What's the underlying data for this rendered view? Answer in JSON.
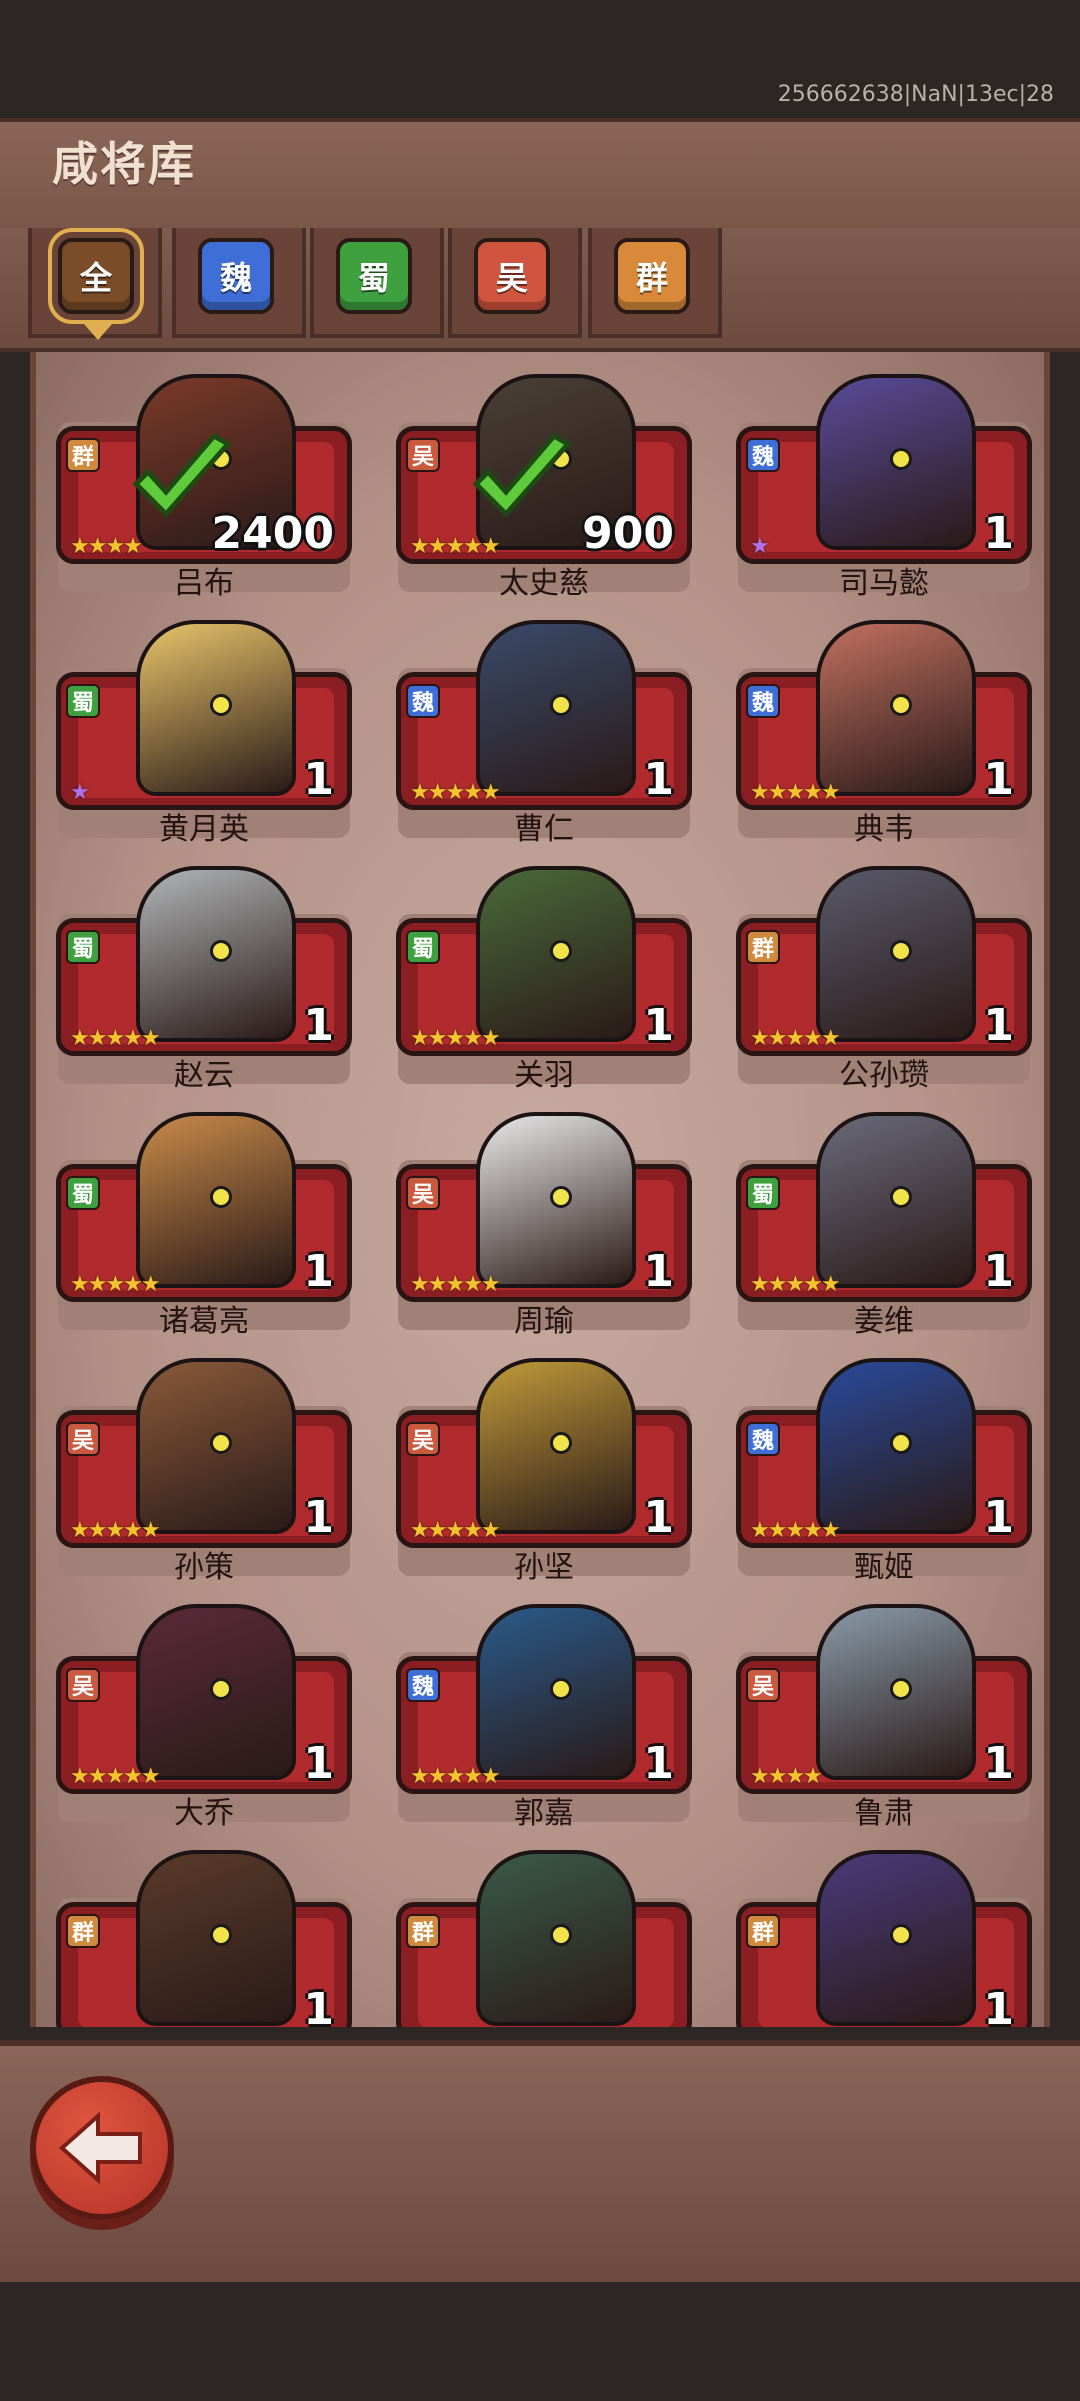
{
  "dev_id": "256662638|NaN|13ec|28",
  "title": "咸将库",
  "tabs": [
    {
      "label": "全",
      "color": "#7a4c28",
      "active": true
    },
    {
      "label": "魏",
      "color": "#3e6ed6",
      "active": false
    },
    {
      "label": "蜀",
      "color": "#3fa040",
      "active": false
    },
    {
      "label": "吴",
      "color": "#d0553e",
      "active": false
    },
    {
      "label": "群",
      "color": "#d88a3a",
      "active": false
    }
  ],
  "heroes": [
    {
      "name": "吕布",
      "faction": "群",
      "stars": "★★★★",
      "count": "2400",
      "checked": true,
      "color": "#7b3a2a"
    },
    {
      "name": "太史慈",
      "faction": "吴",
      "stars": "★★★★★",
      "count": "900",
      "checked": true,
      "color": "#4a4036"
    },
    {
      "name": "司马懿",
      "faction": "魏",
      "stars": "★",
      "count": "1",
      "purple": true,
      "color": "#5a4b9a"
    },
    {
      "name": "黄月英",
      "faction": "蜀",
      "stars": "★",
      "count": "1",
      "purple": true,
      "color": "#e7c46a"
    },
    {
      "name": "曹仁",
      "faction": "魏",
      "stars": "★★★★★",
      "count": "1",
      "color": "#3a4a6a"
    },
    {
      "name": "典韦",
      "faction": "魏",
      "stars": "★★★★★",
      "count": "1",
      "color": "#c07060"
    },
    {
      "name": "赵云",
      "faction": "蜀",
      "stars": "★★★★★",
      "count": "1",
      "color": "#b0b4b6"
    },
    {
      "name": "关羽",
      "faction": "蜀",
      "stars": "★★★★★",
      "count": "1",
      "color": "#4a6a3a"
    },
    {
      "name": "公孙瓒",
      "faction": "群",
      "stars": "★★★★★",
      "count": "1",
      "color": "#5a5a6a"
    },
    {
      "name": "诸葛亮",
      "faction": "蜀",
      "stars": "★★★★★",
      "count": "1",
      "color": "#c88a4a"
    },
    {
      "name": "周瑜",
      "faction": "吴",
      "stars": "★★★★★",
      "count": "1",
      "color": "#e8e8e8"
    },
    {
      "name": "姜维",
      "faction": "蜀",
      "stars": "★★★★★",
      "count": "1",
      "color": "#6a6a7a"
    },
    {
      "name": "孙策",
      "faction": "吴",
      "stars": "★★★★★",
      "count": "1",
      "color": "#8a5a3a"
    },
    {
      "name": "孙坚",
      "faction": "吴",
      "stars": "★★★★★",
      "count": "1",
      "color": "#c09a3a"
    },
    {
      "name": "甄姬",
      "faction": "魏",
      "stars": "★★★★★",
      "count": "1",
      "color": "#2a4a9a"
    },
    {
      "name": "大乔",
      "faction": "吴",
      "stars": "★★★★★",
      "count": "1",
      "color": "#5a2a3a"
    },
    {
      "name": "郭嘉",
      "faction": "魏",
      "stars": "★★★★★",
      "count": "1",
      "color": "#2a5a8a"
    },
    {
      "name": "鲁肃",
      "faction": "吴",
      "stars": "★★★★",
      "count": "1",
      "color": "#8a9aa8"
    },
    {
      "name": "",
      "faction": "群",
      "stars": "",
      "count": "1",
      "color": "#5a3a2a"
    },
    {
      "name": "",
      "faction": "群",
      "stars": "",
      "count": "",
      "color": "#3a5a4a"
    },
    {
      "name": "",
      "faction": "群",
      "stars": "",
      "count": "1",
      "color": "#4a3a7a"
    }
  ],
  "back_icon": "back-arrow-icon"
}
